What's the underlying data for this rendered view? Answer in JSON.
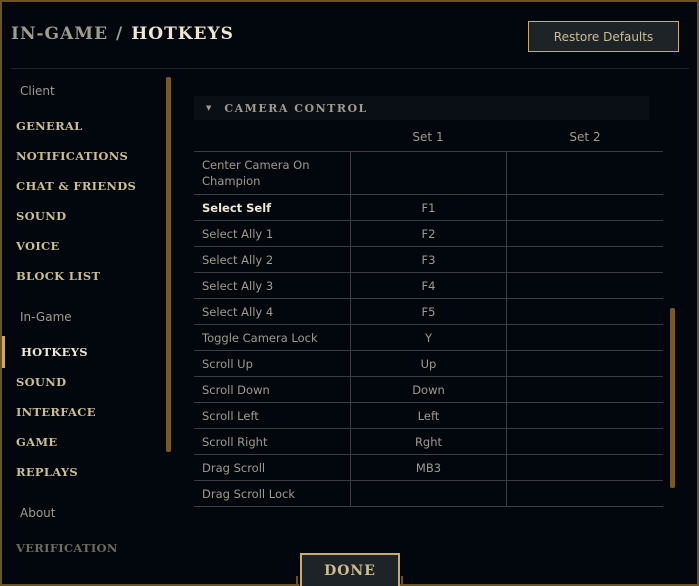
{
  "header": {
    "breadcrumb_parent": "IN-GAME",
    "breadcrumb_separator": "/",
    "breadcrumb_current": "HOTKEYS",
    "restore_defaults_label": "Restore Defaults"
  },
  "sidebar": {
    "groups": [
      {
        "label": "Client",
        "items": [
          "GENERAL",
          "NOTIFICATIONS",
          "CHAT & FRIENDS",
          "SOUND",
          "VOICE",
          "BLOCK LIST"
        ]
      },
      {
        "label": "In-Game",
        "items": [
          "HOTKEYS",
          "SOUND",
          "INTERFACE",
          "GAME",
          "REPLAYS"
        ]
      },
      {
        "label": "About",
        "items": [
          "VERIFICATION"
        ]
      }
    ],
    "active_item": "HOTKEYS"
  },
  "section": {
    "title": "CAMERA CONTROL",
    "expanded": true,
    "columns": [
      "Set 1",
      "Set 2"
    ],
    "rows": [
      {
        "action": "Center Camera On Champion",
        "set1": "",
        "set2": ""
      },
      {
        "action": "Select Self",
        "set1": "F1",
        "set2": ""
      },
      {
        "action": "Select Ally 1",
        "set1": "F2",
        "set2": ""
      },
      {
        "action": "Select Ally 2",
        "set1": "F3",
        "set2": ""
      },
      {
        "action": "Select Ally 3",
        "set1": "F4",
        "set2": ""
      },
      {
        "action": "Select Ally 4",
        "set1": "F5",
        "set2": ""
      },
      {
        "action": "Toggle Camera Lock",
        "set1": "Y",
        "set2": ""
      },
      {
        "action": "Scroll Up",
        "set1": "Up",
        "set2": ""
      },
      {
        "action": "Scroll Down",
        "set1": "Down",
        "set2": ""
      },
      {
        "action": "Scroll Left",
        "set1": "Left",
        "set2": ""
      },
      {
        "action": "Scroll Right",
        "set1": "Rght",
        "set2": ""
      },
      {
        "action": "Drag Scroll",
        "set1": "MB3",
        "set2": ""
      },
      {
        "action": "Drag Scroll Lock",
        "set1": "",
        "set2": ""
      }
    ]
  },
  "footer": {
    "done_label": "DONE"
  },
  "colors": {
    "gold": "#c8aa6e",
    "gold_dark": "#785a28",
    "text": "#a09b8c",
    "text_bright": "#f0e6d2",
    "background": "#010a13"
  }
}
